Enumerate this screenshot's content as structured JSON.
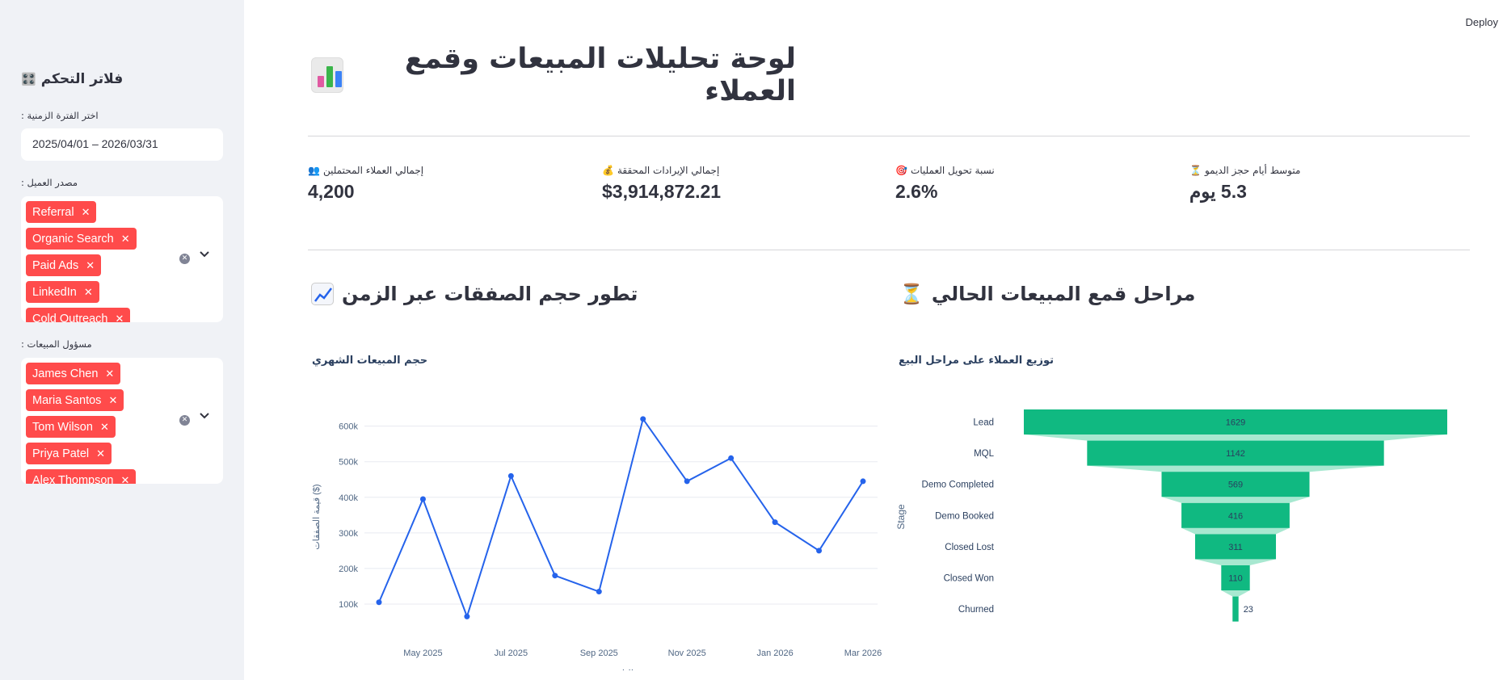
{
  "toolbar": {
    "deploy_label": "Deploy"
  },
  "sidebar": {
    "title": "فلاتر التحكم",
    "title_icon": "control-knobs-icon",
    "date_label": "اختر الفترة الزمنية :",
    "date_value": "2025/04/01 – 2026/03/31",
    "source_label": "مصدر العميل :",
    "sources": [
      "Referral",
      "Organic Search",
      "Paid Ads",
      "LinkedIn",
      "Cold Outreach"
    ],
    "rep_label": "مسؤول المبيعات :",
    "reps": [
      "James Chen",
      "Maria Santos",
      "Tom Wilson",
      "Priya Patel",
      "Alex Thompson"
    ],
    "tag_color": "#ff4b4b"
  },
  "main": {
    "title": "لوحة تحليلات المبيعات وقمع العملاء",
    "title_icon": "bar-chart-icon",
    "metrics": [
      {
        "label": "إجمالي العملاء المحتملين",
        "icon": "people-icon",
        "emoji": "👥",
        "value": "4,200"
      },
      {
        "label": "إجمالي الإيرادات المحققة",
        "icon": "money-bag-icon",
        "emoji": "💰",
        "value": "$3,914,872.21"
      },
      {
        "label": "نسبة تحويل العمليات",
        "icon": "target-icon",
        "emoji": "🎯",
        "value": "2.6%"
      },
      {
        "label": "متوسط أيام حجز الديمو",
        "icon": "hourglass-icon",
        "emoji": "⏳",
        "value": "5.3 يوم"
      }
    ],
    "left_section": {
      "title": "تطور حجم الصفقات عبر الزمن",
      "icon": "trend-chart-icon"
    },
    "right_section": {
      "title": "مراحل قمع المبيعات الحالي",
      "icon": "hourglass-icon"
    }
  },
  "chart_data": [
    {
      "type": "line",
      "title": "حجم المبيعات الشهري",
      "xlabel": "التاريخ",
      "ylabel": "قيمة الصفقات ($)",
      "x": [
        "2025-04",
        "2025-05",
        "2025-06",
        "2025-07",
        "2025-08",
        "2025-09",
        "2025-10",
        "2025-11",
        "2025-12",
        "2026-01",
        "2026-02",
        "2026-03"
      ],
      "x_ticks": [
        "May 2025",
        "Jul 2025",
        "Sep 2025",
        "Nov 2025",
        "Jan 2026",
        "Mar 2026"
      ],
      "values": [
        105000,
        395000,
        65000,
        460000,
        180000,
        135000,
        620000,
        445000,
        510000,
        330000,
        250000,
        445000
      ],
      "y_ticks": [
        "100k",
        "200k",
        "300k",
        "400k",
        "500k",
        "600k"
      ],
      "ylim": [
        50000,
        640000
      ],
      "line_color": "#2563eb",
      "grid": true
    },
    {
      "type": "funnel",
      "title": "توزيع العملاء على مراحل البيع",
      "ylabel": "Stage",
      "categories": [
        "Lead",
        "MQL",
        "Demo Completed",
        "Demo Booked",
        "Closed Lost",
        "Closed Won",
        "Churned"
      ],
      "values": [
        1629,
        1142,
        569,
        416,
        311,
        110,
        23
      ],
      "bar_color": "#10b981",
      "connector_color": "#a7e8d0"
    }
  ]
}
